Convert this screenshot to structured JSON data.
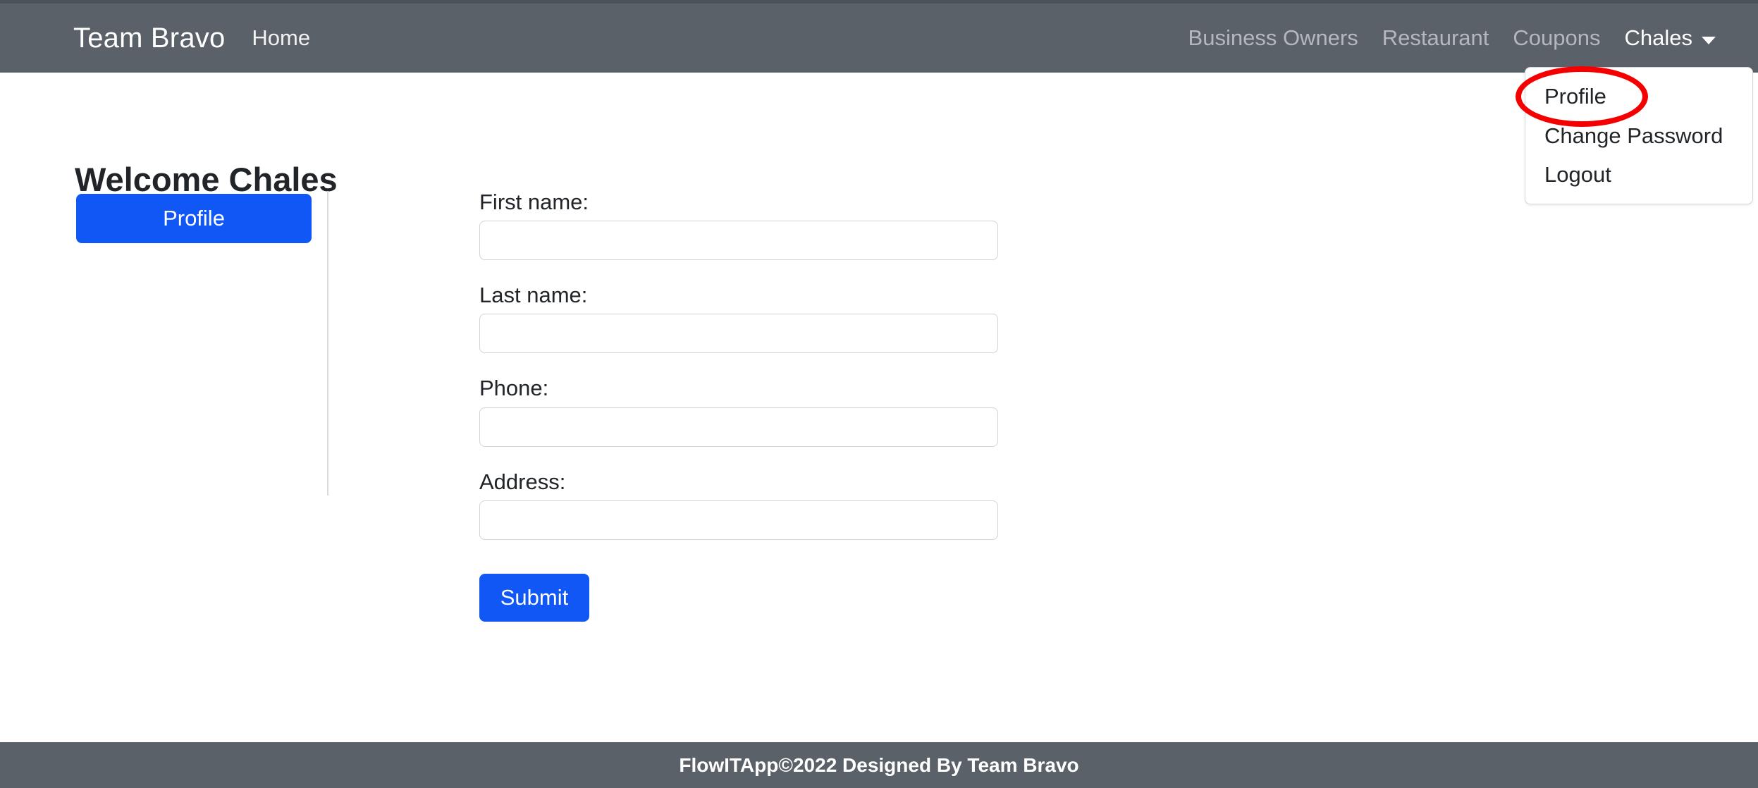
{
  "navbar": {
    "brand": "Team Bravo",
    "home_label": "Home",
    "links": [
      {
        "label": "Business Owners"
      },
      {
        "label": "Restaurant"
      },
      {
        "label": "Coupons"
      }
    ],
    "user": {
      "name": "Chales",
      "caret_icon": "chevron-down-icon"
    }
  },
  "dropdown": {
    "items": [
      {
        "label": "Profile"
      },
      {
        "label": "Change Password"
      },
      {
        "label": "Logout"
      }
    ]
  },
  "annotation": {
    "shape": "ellipse",
    "color": "#f50000",
    "targets": "Profile"
  },
  "main": {
    "title": "Welcome Chales",
    "sidebar": {
      "profile_button": "Profile"
    },
    "form": {
      "fields": [
        {
          "label": "First name:",
          "value": "",
          "placeholder": ""
        },
        {
          "label": "Last name:",
          "value": "",
          "placeholder": ""
        },
        {
          "label": "Phone:",
          "value": "",
          "placeholder": ""
        },
        {
          "label": "Address:",
          "value": "",
          "placeholder": ""
        }
      ],
      "submit_label": "Submit"
    }
  },
  "footer": {
    "text": "FlowITApp©2022 Designed By Team Bravo"
  },
  "colors": {
    "navbar": "#5a6169",
    "accent_blue": "#1157f6",
    "annotation_red": "#f50000",
    "footer": "#5a6169"
  }
}
